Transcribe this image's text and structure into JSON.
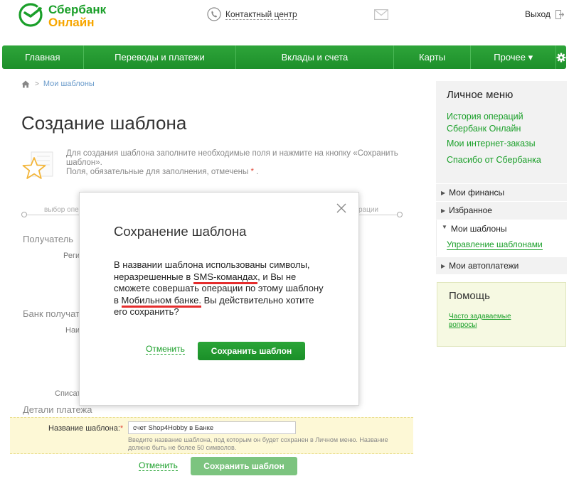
{
  "header": {
    "logo_line1": "Сбербанк",
    "logo_line2": "Онлайн",
    "contact_center": "Контактный центр",
    "exit": "Выход"
  },
  "nav": {
    "items": [
      "Главная",
      "Переводы и платежи",
      "Вклады и счета",
      "Карты",
      "Прочее ▾"
    ]
  },
  "breadcrumb": {
    "link": "Мои шаблоны"
  },
  "page": {
    "title": "Создание шаблона",
    "info_text": "Для создания шаблона заполните необходимые поля и нажмите на кнопку «Сохранить шаблон».",
    "required_note": "Поля, обязательные для заполнения, отмечены",
    "required_mark": "*",
    "required_tail": ".",
    "step_left": "выбор опе",
    "step_right": "рации",
    "section_recipient": "Получатель",
    "stub_region": "Реги",
    "section_bank": "Банк получат",
    "stub_name": "Наи",
    "stub_debit": "Списат",
    "section_details": "Детали платежа"
  },
  "form": {
    "template_label": "Название шаблона:",
    "template_required": "*",
    "template_value": "счет Shop4Hobby в Банке",
    "template_hint": "Введите название шаблона, под которым он будет сохранен в Личном меню. Название должно быть не более 50 символов.",
    "cancel": "Отменить",
    "save": "Сохранить шаблон"
  },
  "sidebar": {
    "title": "Личное меню",
    "links": [
      "История операций Сбербанк Онлайн",
      "Мои интернет-заказы",
      "Спасибо от Сбербанка"
    ],
    "categories": [
      "Мои финансы",
      "Избранное",
      "Мои шаблоны",
      "Мои автоплатежи"
    ],
    "sub_link": "Управление шаблонами",
    "help_title": "Помощь",
    "help_link": "Часто задаваемые вопросы"
  },
  "modal": {
    "title": "Сохранение шаблона",
    "body_1": "В названии шаблона использованы символы, неразрешенные в ",
    "hl_1": "SMS-командах",
    "body_2": ", и Вы не сможете совершать операции по этому шаблону в ",
    "hl_2": "Мобильном банке.",
    "body_3": " Вы действительно хотите его сохранить?",
    "cancel": "Отменить",
    "save": "Сохранить шаблон"
  },
  "colors": {
    "brand_green": "#1a9f29",
    "brand_orange": "#f7a600",
    "highlight_red": "#e52d2d",
    "nav_green": "#1d8f2a"
  }
}
